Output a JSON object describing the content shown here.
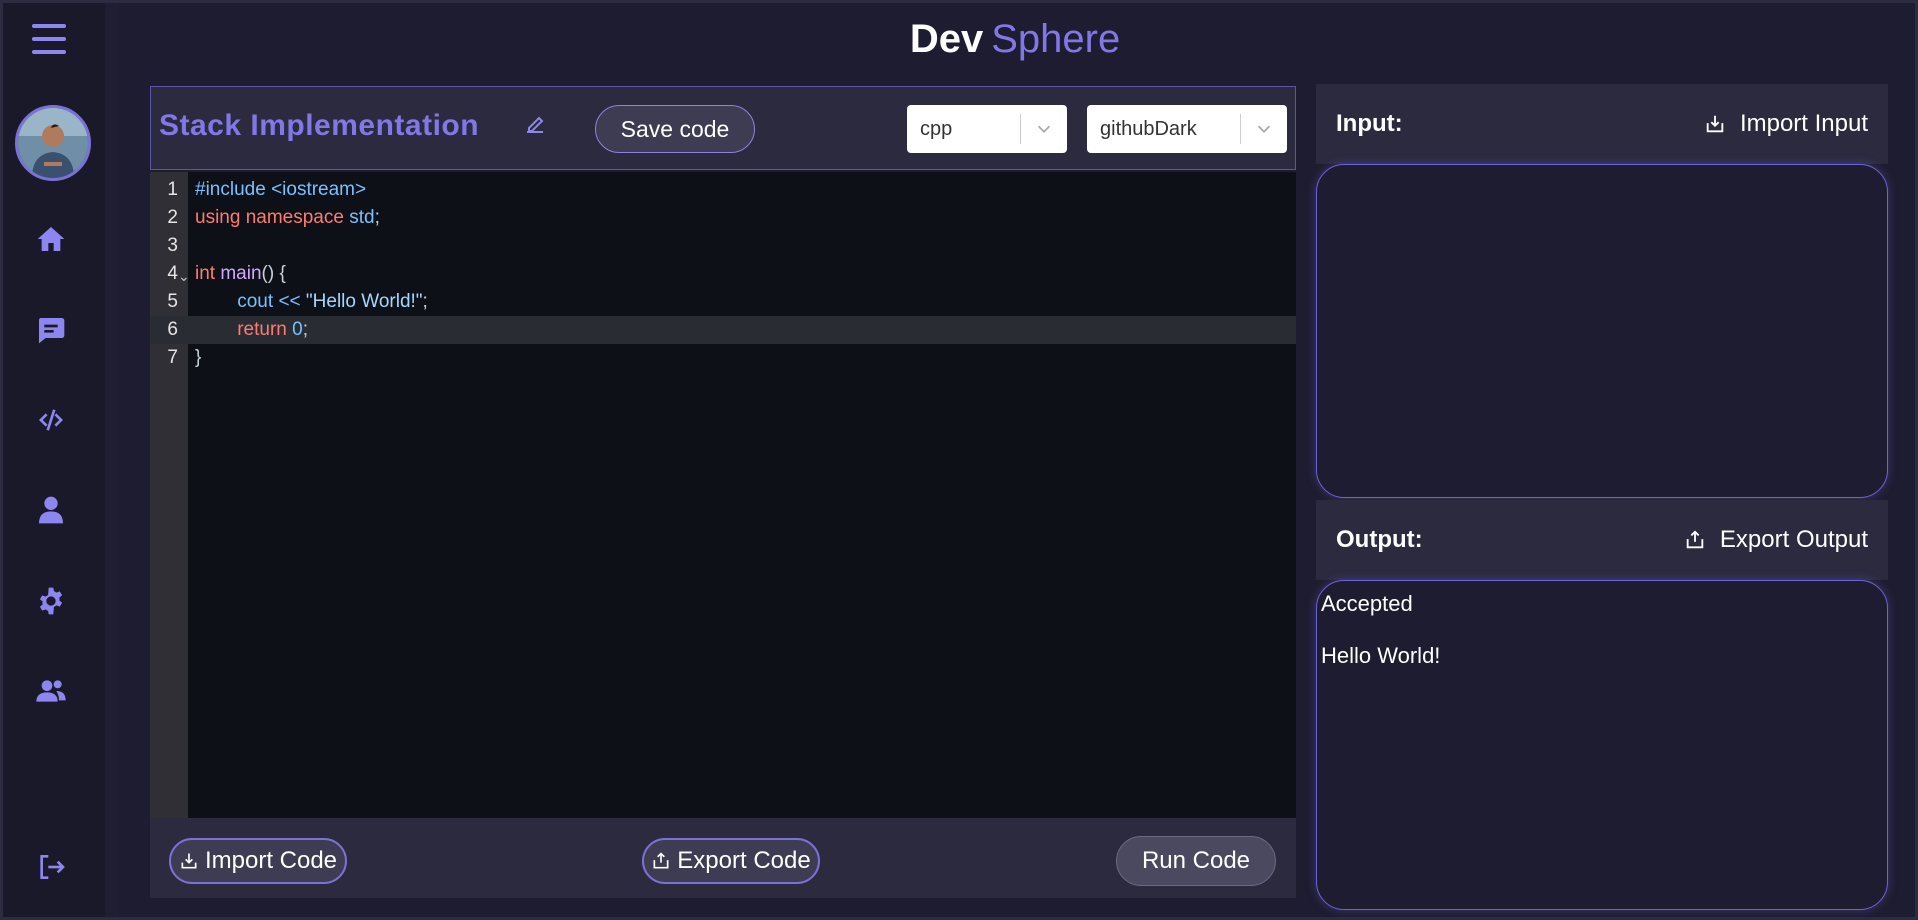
{
  "brand": {
    "dev": "Dev",
    "sphere": "Sphere"
  },
  "sidebar": {
    "items": [
      {
        "icon": "home-icon"
      },
      {
        "icon": "chat-icon"
      },
      {
        "icon": "code-icon"
      },
      {
        "icon": "user-icon"
      },
      {
        "icon": "gear-icon"
      },
      {
        "icon": "users-icon"
      }
    ],
    "logout_icon": "logout-icon"
  },
  "editor": {
    "title": "Stack Implementation",
    "save_label": "Save code",
    "language": "cpp",
    "theme": "githubDark",
    "lines": [
      {
        "num": "1",
        "code": "#include <iostream>"
      },
      {
        "num": "2",
        "code": "using namespace std;"
      },
      {
        "num": "3",
        "code": ""
      },
      {
        "num": "4",
        "code": "int main() {"
      },
      {
        "num": "5",
        "code": "        cout << \"Hello World!\";"
      },
      {
        "num": "6",
        "code": "        return 0;"
      },
      {
        "num": "7",
        "code": "}"
      }
    ],
    "import_label": "Import Code",
    "export_label": "Export Code",
    "run_label": "Run Code"
  },
  "input": {
    "label": "Input:",
    "action_label": "Import Input",
    "value": ""
  },
  "output": {
    "label": "Output:",
    "action_label": "Export Output",
    "status": "Accepted",
    "text": "Hello World!"
  },
  "colors": {
    "accent": "#8178e6",
    "background": "#1d1c30",
    "panel": "#2b2a3e",
    "code_bg": "#0d1017"
  }
}
